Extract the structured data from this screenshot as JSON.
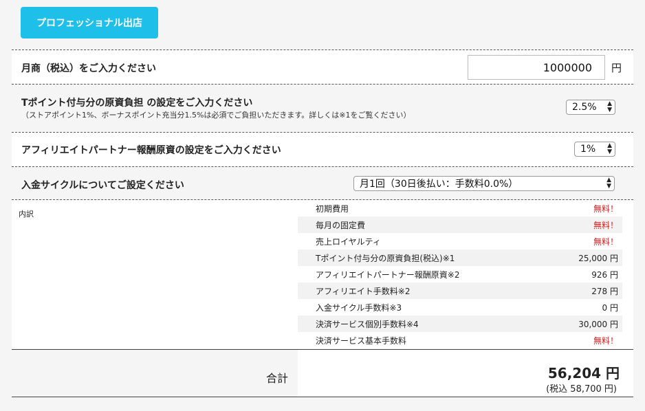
{
  "header": {
    "pro_button": "プロフェッショナル出店"
  },
  "monthly_sales": {
    "label": "月商（税込）をご入力ください",
    "value": "1000000",
    "unit": "円"
  },
  "tpoint": {
    "label": "Tポイント付与分の原資負担 の設定をご入力ください",
    "sub": "（ストアポイント1%、ボーナスポイント充当分1.5%は必須でご負担いただきます。詳しくは※1をご覧ください）",
    "selected": "2.5%"
  },
  "affiliate": {
    "label": "アフィリエイトパートナー報酬原資の設定をご入力ください",
    "selected": "1%"
  },
  "cycle": {
    "label": "入金サイクルについてご設定ください",
    "selected": "月1回（30日後払い：手数料0.0%）"
  },
  "breakdown": {
    "label": "内訳",
    "items": [
      {
        "name": "初期費用",
        "value": "無料！",
        "free": true
      },
      {
        "name": "毎月の固定費",
        "value": "無料！",
        "free": true
      },
      {
        "name": "売上ロイヤルティ",
        "value": "無料！",
        "free": true
      },
      {
        "name": "Tポイント付与分の原資負担(税込)※1",
        "value": "25,000 円",
        "free": false
      },
      {
        "name": "アフィリエイトパートナー報酬原資※2",
        "value": "926 円",
        "free": false
      },
      {
        "name": "アフィリエイト手数料※2",
        "value": "278 円",
        "free": false
      },
      {
        "name": "入金サイクル手数料※3",
        "value": "0 円",
        "free": false
      },
      {
        "name": "決済サービス個別手数料※4",
        "value": "30,000 円",
        "free": false
      },
      {
        "name": "決済サービス基本手数料",
        "value": "無料！",
        "free": true
      }
    ]
  },
  "total": {
    "label": "合計",
    "value": "56,204 円",
    "tax_included": "(税込 58,700 円)"
  },
  "colors": {
    "accent": "#1ec0ea",
    "free": "#e02020"
  }
}
